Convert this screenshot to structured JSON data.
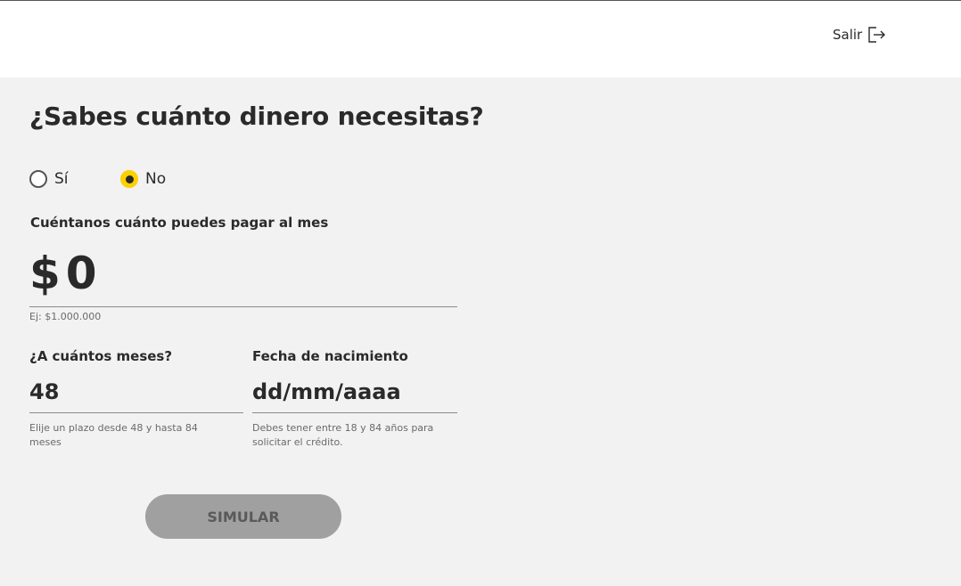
{
  "header": {
    "logout_label": "Salir",
    "logout_icon": "logout-arrow-icon"
  },
  "form": {
    "title": "¿Sabes cuánto dinero necesitas?",
    "knows_amount": {
      "options": [
        {
          "label": "Sí",
          "selected": false
        },
        {
          "label": "No",
          "selected": true
        }
      ]
    },
    "monthly_payment": {
      "label": "Cuéntanos cuánto puedes pagar al mes",
      "currency": "$",
      "value": "0",
      "hint": "Ej: $1.000.000"
    },
    "months": {
      "label": "¿A cuántos meses?",
      "value": "48",
      "hint": "Elije un plazo desde 48 y hasta 84 meses"
    },
    "birth_date": {
      "label": "Fecha de nacimiento",
      "placeholder": "dd/mm/aaaa",
      "value": "",
      "hint": "Debes tener entre 18 y 84 años para solicitar el crédito."
    },
    "submit_label": "SIMULAR"
  },
  "colors": {
    "accent": "#fdd000",
    "background": "#f2f2f2",
    "button_disabled": "#a0a0a0"
  }
}
